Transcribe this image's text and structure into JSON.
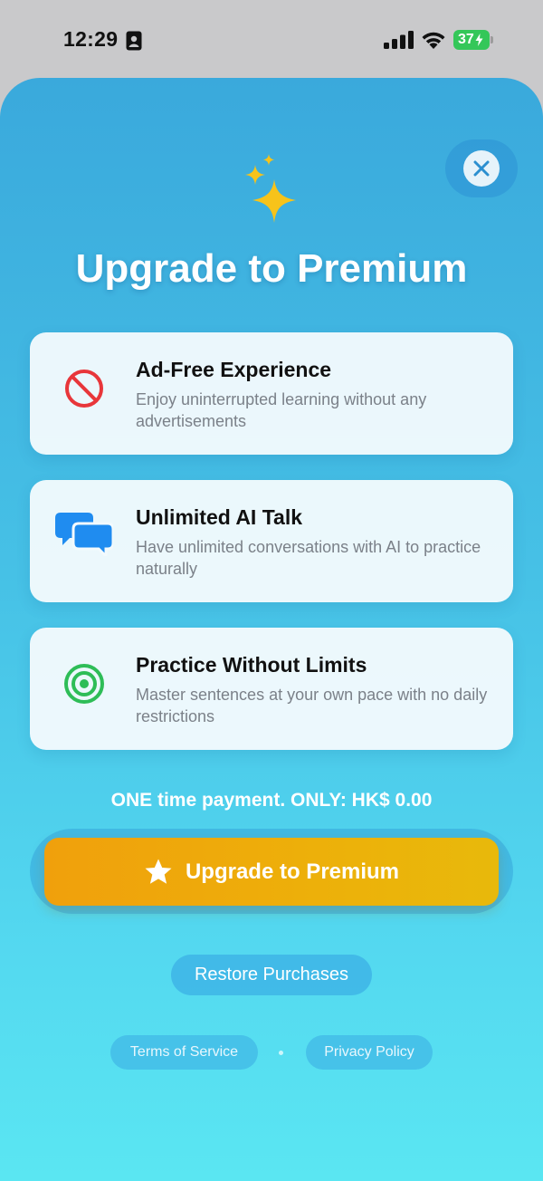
{
  "status_bar": {
    "time": "12:29",
    "battery": "37"
  },
  "title": "Upgrade to Premium",
  "features": [
    {
      "title": "Ad-Free Experience",
      "description": "Enjoy uninterrupted learning without any advertisements",
      "icon": "no-ads-icon"
    },
    {
      "title": "Unlimited AI Talk",
      "description": "Have unlimited conversations with AI to practice naturally",
      "icon": "chat-bubbles-icon"
    },
    {
      "title": "Practice Without Limits",
      "description": "Master sentences at your own pace with no daily restrictions",
      "icon": "target-icon"
    }
  ],
  "price_text": "ONE time payment. ONLY: HK$ 0.00",
  "upgrade_button": "Upgrade to Premium",
  "restore_button": "Restore Purchases",
  "footer": {
    "terms": "Terms of Service",
    "privacy": "Privacy Policy"
  },
  "colors": {
    "accent_orange": "#f0a00c",
    "sky_blue": "#3aa9dc",
    "prohibit_red": "#e8363a",
    "chat_blue": "#1f8cf0",
    "target_green": "#2ebd57"
  }
}
